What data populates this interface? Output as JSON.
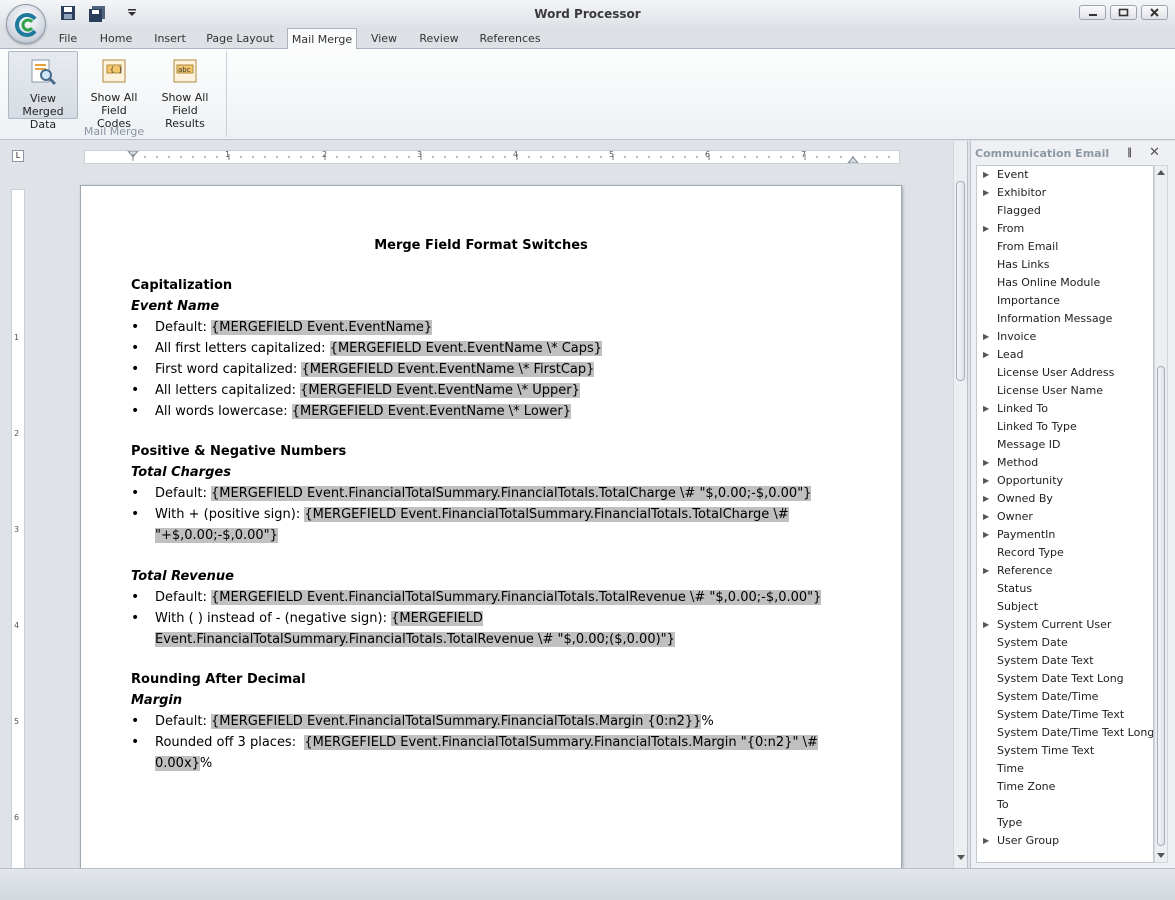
{
  "app": {
    "title": "Word Processor"
  },
  "tabs": [
    "File",
    "Home",
    "Insert",
    "Page Layout",
    "Mail Merge",
    "View",
    "Review",
    "References"
  ],
  "active_tab": "Mail Merge",
  "ribbon": {
    "buttons": [
      {
        "line1": "View Merged",
        "line2": "Data",
        "pressed": true
      },
      {
        "line1": "Show All",
        "line2": "Field Codes"
      },
      {
        "line1": "Show All",
        "line2": "Field Results"
      }
    ],
    "group_label": "Mail Merge"
  },
  "ruler": {
    "h_numbers": [
      "1",
      "2",
      "3",
      "4",
      "5",
      "6",
      "7"
    ],
    "v_numbers": [
      "1",
      "2",
      "3",
      "4",
      "5",
      "6"
    ]
  },
  "document": {
    "title": "Merge Field Format Switches",
    "s1_heading": "Capitalization",
    "s1_sub": "Event Name",
    "s1_b1_label": "Default: ",
    "s1_b1_field": "{MERGEFIELD Event.EventName}",
    "s1_b2_label": "All first letters capitalized: ",
    "s1_b2_field": "{MERGEFIELD Event.EventName \\* Caps}",
    "s1_b3_label": "First word capitalized: ",
    "s1_b3_field": "{MERGEFIELD Event.EventName \\* FirstCap}",
    "s1_b4_label": "All letters capitalized: ",
    "s1_b4_field": "{MERGEFIELD Event.EventName \\* Upper}",
    "s1_b5_label": "All words lowercase: ",
    "s1_b5_field": "{MERGEFIELD Event.EventName \\* Lower}",
    "s2_heading": "Positive & Negative Numbers",
    "s2_sub1": "Total Charges",
    "s2_b1_label": "Default: ",
    "s2_b1_field": "{MERGEFIELD Event.FinancialTotalSummary.FinancialTotals.TotalCharge \\# \"$,0.00;-$,0.00\"}",
    "s2_b2_label": "With + (positive sign): ",
    "s2_b2_field_a": "{MERGEFIELD Event.FinancialTotalSummary.FinancialTotals.TotalCharge \\#",
    "s2_b2_field_b": "\"+$,0.00;-$,0.00\"}",
    "s2_sub2": "Total Revenue",
    "s2_b3_label": "Default: ",
    "s2_b3_field": "{MERGEFIELD Event.FinancialTotalSummary.FinancialTotals.TotalRevenue \\# \"$,0.00;-$,0.00\"}",
    "s2_b4_label": "With ( ) instead of - (negative sign): ",
    "s2_b4_field_a": "{MERGEFIELD",
    "s2_b4_field_b": "Event.FinancialTotalSummary.FinancialTotals.TotalRevenue \\# \"$,0.00;($,0.00)\"}",
    "s3_heading": "Rounding After Decimal",
    "s3_sub": "Margin",
    "s3_b1_label": "Default: ",
    "s3_b1_field": "{MERGEFIELD Event.FinancialTotalSummary.FinancialTotals.Margin {0:n2}}",
    "s3_b1_suffix": "%",
    "s3_b2_label": "Rounded off 3 places:  ",
    "s3_b2_field_a": "{MERGEFIELD Event.FinancialTotalSummary.FinancialTotals.Margin \"{0:n2}\" \\#",
    "s3_b2_field_b": "0.00x}",
    "s3_b2_suffix": "%"
  },
  "pane": {
    "title": "Communication Email",
    "items": [
      {
        "label": "Event",
        "expandable": true
      },
      {
        "label": "Exhibitor",
        "expandable": true
      },
      {
        "label": "Flagged",
        "expandable": false
      },
      {
        "label": "From",
        "expandable": true
      },
      {
        "label": "From Email",
        "expandable": false
      },
      {
        "label": "Has Links",
        "expandable": false
      },
      {
        "label": "Has Online Module",
        "expandable": false
      },
      {
        "label": "Importance",
        "expandable": false
      },
      {
        "label": "Information Message",
        "expandable": false
      },
      {
        "label": "Invoice",
        "expandable": true
      },
      {
        "label": "Lead",
        "expandable": true
      },
      {
        "label": "License User Address",
        "expandable": false
      },
      {
        "label": "License User Name",
        "expandable": false
      },
      {
        "label": "Linked To",
        "expandable": true
      },
      {
        "label": "Linked To Type",
        "expandable": false
      },
      {
        "label": "Message ID",
        "expandable": false
      },
      {
        "label": "Method",
        "expandable": true
      },
      {
        "label": "Opportunity",
        "expandable": true
      },
      {
        "label": "Owned By",
        "expandable": true
      },
      {
        "label": "Owner",
        "expandable": true
      },
      {
        "label": "PaymentIn",
        "expandable": true
      },
      {
        "label": "Record Type",
        "expandable": false
      },
      {
        "label": "Reference",
        "expandable": true
      },
      {
        "label": "Status",
        "expandable": false
      },
      {
        "label": "Subject",
        "expandable": false
      },
      {
        "label": "System Current User",
        "expandable": true
      },
      {
        "label": "System Date",
        "expandable": false
      },
      {
        "label": "System Date Text",
        "expandable": false
      },
      {
        "label": "System Date Text Long",
        "expandable": false
      },
      {
        "label": "System Date/Time",
        "expandable": false
      },
      {
        "label": "System Date/Time Text",
        "expandable": false
      },
      {
        "label": "System Date/Time Text Long",
        "expandable": false
      },
      {
        "label": "System Time Text",
        "expandable": false
      },
      {
        "label": "Time",
        "expandable": false
      },
      {
        "label": "Time Zone",
        "expandable": false
      },
      {
        "label": "To",
        "expandable": false
      },
      {
        "label": "Type",
        "expandable": false
      },
      {
        "label": "User Group",
        "expandable": true
      }
    ]
  }
}
